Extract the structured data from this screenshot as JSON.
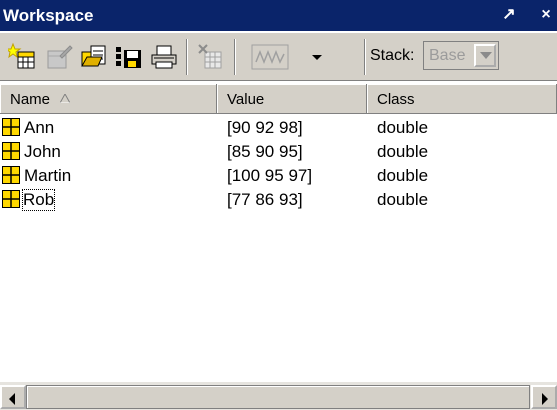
{
  "window": {
    "title": "Workspace",
    "undock_glyph": "↗",
    "close_glyph": "×"
  },
  "toolbar": {
    "icons": [
      "new-variable-icon",
      "open-selection-icon",
      "import-data-icon",
      "save-workspace-icon",
      "print-icon",
      "delete-icon",
      "plot-icon",
      "plot-dropdown-icon"
    ],
    "stack_label": "Stack:",
    "stack_value": "Base"
  },
  "columns": {
    "name": "Name",
    "value": "Value",
    "class": "Class",
    "sorted_by": "name",
    "sort_direction": "ascending"
  },
  "variables": [
    {
      "name": "Ann",
      "value": "[90 92 98]",
      "class": "double"
    },
    {
      "name": "John",
      "value": "[85 90 95]",
      "class": "double"
    },
    {
      "name": "Martin",
      "value": "[100 95 97]",
      "class": "double"
    },
    {
      "name": "Rob",
      "value": "[77 86 93]",
      "class": "double"
    }
  ],
  "focused_variable": "Rob",
  "colors": {
    "titlebar": "#0a246a",
    "chrome": "#d4d0c8",
    "matrix_icon": "#ffd800"
  }
}
